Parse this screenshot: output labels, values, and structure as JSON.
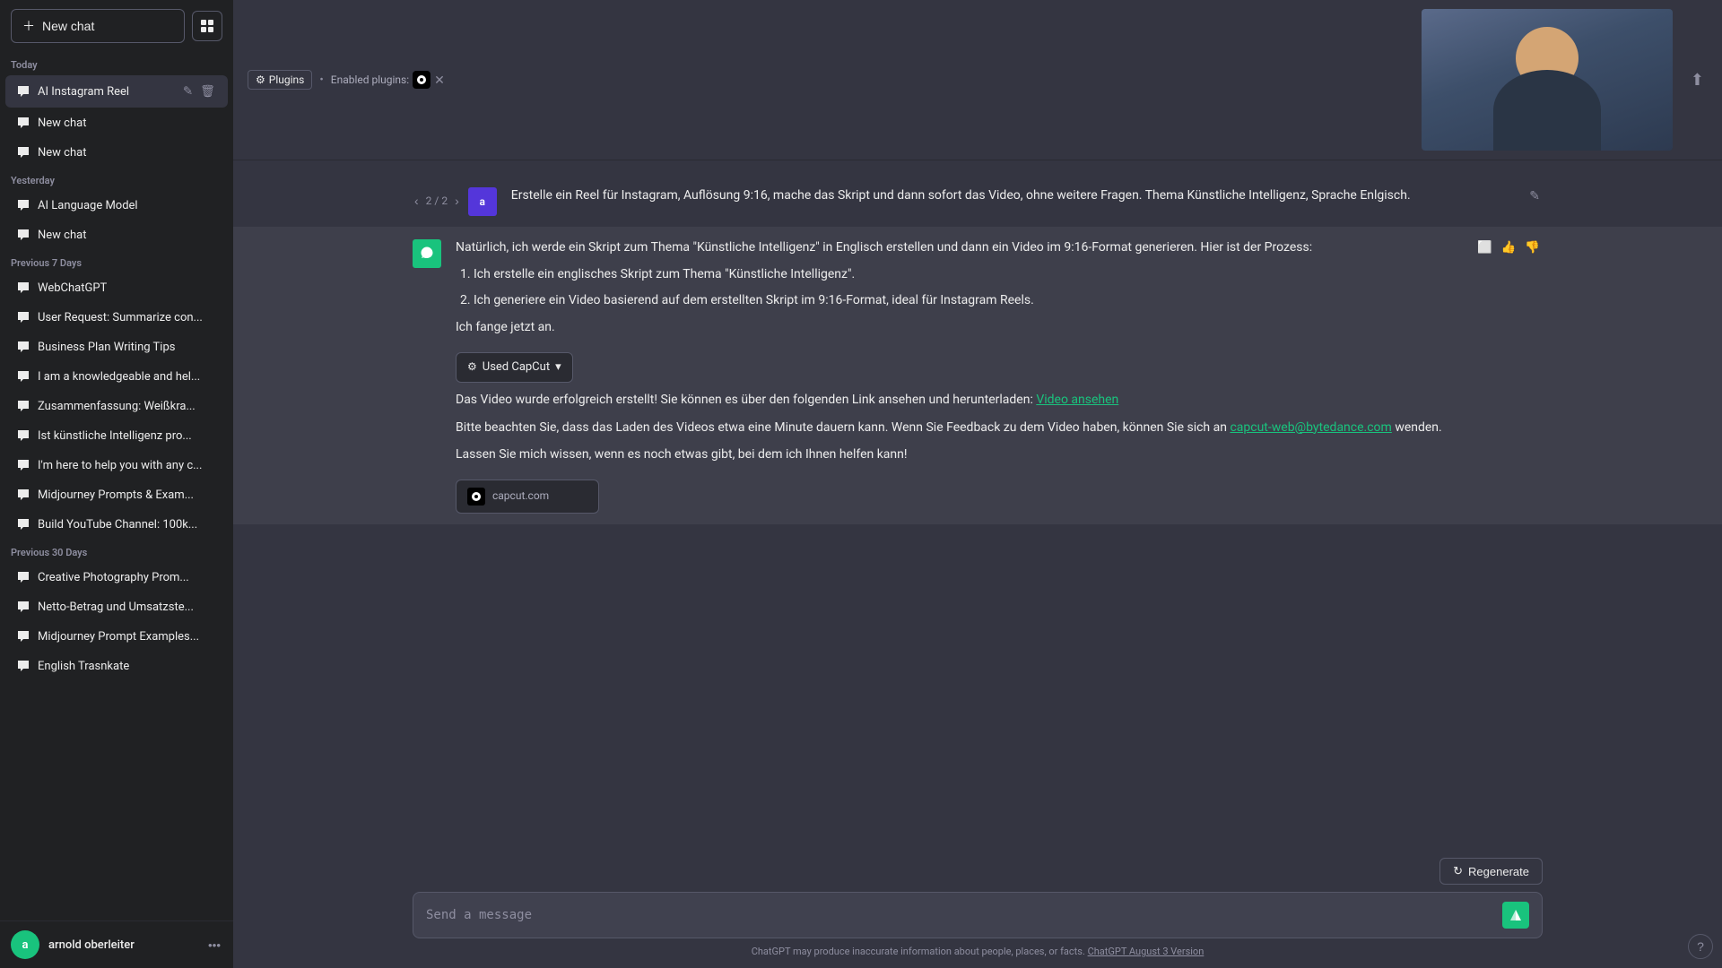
{
  "app": {
    "title": "ChatGPT"
  },
  "sidebar": {
    "new_chat_label": "New chat",
    "sections": [
      {
        "label": "Today",
        "items": [
          {
            "id": "ai-instagram-reel",
            "text": "AI Instagram Reel",
            "active": true
          }
        ]
      },
      {
        "label": "",
        "items": [
          {
            "id": "new-chat-1",
            "text": "New chat"
          },
          {
            "id": "new-chat-2",
            "text": "New chat"
          }
        ]
      },
      {
        "label": "Yesterday",
        "items": [
          {
            "id": "ai-language-model",
            "text": "AI Language Model"
          },
          {
            "id": "new-chat-3",
            "text": "New chat"
          }
        ]
      },
      {
        "label": "Previous 7 Days",
        "items": [
          {
            "id": "webchastgpt",
            "text": "WebChatGPT"
          },
          {
            "id": "user-request",
            "text": "User Request: Summarize con..."
          },
          {
            "id": "business-plan",
            "text": "Business Plan Writing Tips"
          },
          {
            "id": "knowledgeable",
            "text": "I am a knowledgeable and hel..."
          },
          {
            "id": "zusammenfassung",
            "text": "Zusammenfassung: Weißkra..."
          },
          {
            "id": "ist-kunstliche",
            "text": "Ist künstliche Intelligenz pro..."
          },
          {
            "id": "im-here",
            "text": "I'm here to help you with any c..."
          },
          {
            "id": "midjourney-prompts",
            "text": "Midjourney Prompts & Exam..."
          },
          {
            "id": "build-youtube",
            "text": "Build YouTube Channel: 100k..."
          }
        ]
      },
      {
        "label": "Previous 30 Days",
        "items": [
          {
            "id": "creative-photography",
            "text": "Creative Photography Prom..."
          },
          {
            "id": "netto-betrag",
            "text": "Netto-Betrag und Umsatzste..."
          },
          {
            "id": "midjourney-examples",
            "text": "Midjourney Prompt Examples..."
          },
          {
            "id": "english-trasnkate",
            "text": "English Trasnkate"
          }
        ]
      }
    ],
    "footer": {
      "username": "arnold oberleiter",
      "avatar_initials": "a"
    }
  },
  "topbar": {
    "plugins_label": "Plugins",
    "enabled_plugins_label": "Enabled plugins:",
    "capcut_name": "CapCut"
  },
  "messages": [
    {
      "role": "user",
      "avatar": "a",
      "pagination": "2 / 2",
      "text": "Erstelle ein Reel für Instagram, Auflösung 9:16, mache das Skript und dann sofort das Video, ohne weitere Fragen. Thema Künstliche Intelligenz, Sprache Enlgisch."
    },
    {
      "role": "ai",
      "text_intro": "Natürlich, ich werde ein Skript zum Thema \"Künstliche Intelligenz\" in Englisch erstellen und dann ein Video im 9:16-Format generieren. Hier ist der Prozess:",
      "steps": [
        "Ich erstelle ein englisches Skript zum Thema \"Künstliche Intelligenz\".",
        "Ich generiere ein Video basierend auf dem erstellten Skript im 9:16-Format, ideal für Instagram Reels."
      ],
      "text_start": "Ich fange jetzt an.",
      "plugin_used": "Used CapCut",
      "text_success": "Das Video wurde erfolgreich erstellt! Sie können es über den folgenden Link ansehen und herunterladen:",
      "link_text": "Video ansehen",
      "text_notice": "Bitte beachten Sie, dass das Laden des Videos etwa eine Minute dauern kann. Wenn Sie Feedback zu dem Video haben, können Sie sich an",
      "email": "capcut-web@bytedance.com",
      "text_after_email": "wenden.",
      "text_help": "Lassen Sie mich wissen, wenn es noch etwas gibt, bei dem ich Ihnen helfen kann!",
      "link_card_label": "capcut.com"
    }
  ],
  "input": {
    "placeholder": "Send a message",
    "disclaimer": "ChatGPT may produce inaccurate information about people, places, or facts.",
    "disclaimer_link": "ChatGPT August 3 Version",
    "regenerate_label": "Regenerate"
  }
}
